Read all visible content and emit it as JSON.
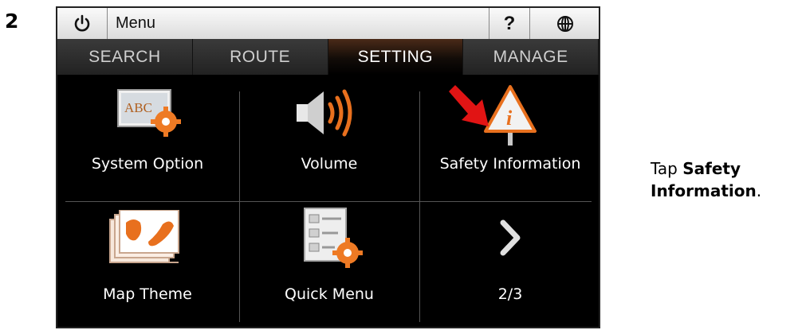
{
  "step_number": "2",
  "topbar": {
    "power_icon": "power-icon",
    "menu_title": "Menu",
    "help_label": "?",
    "globe_icon": "globe-icon"
  },
  "tabs": [
    {
      "label": "SEARCH",
      "active": false
    },
    {
      "label": "ROUTE",
      "active": false
    },
    {
      "label": "SETTING",
      "active": true
    },
    {
      "label": "MANAGE",
      "active": false
    }
  ],
  "grid_items": [
    {
      "label": "System Option",
      "icon": "system-option-icon"
    },
    {
      "label": "Volume",
      "icon": "volume-icon"
    },
    {
      "label": "Safety Information",
      "icon": "safety-information-icon"
    },
    {
      "label": "Map Theme",
      "icon": "map-theme-icon"
    },
    {
      "label": "Quick Menu",
      "icon": "quick-menu-icon"
    },
    {
      "label": "2/3",
      "icon": "next-page-icon"
    }
  ],
  "instruction": {
    "prefix": "Tap ",
    "bold": "Safety Information",
    "suffix": "."
  },
  "colors": {
    "accent_orange": "#e8701e",
    "pointer_red": "#e11414",
    "active_tab": "#3a1f10"
  }
}
